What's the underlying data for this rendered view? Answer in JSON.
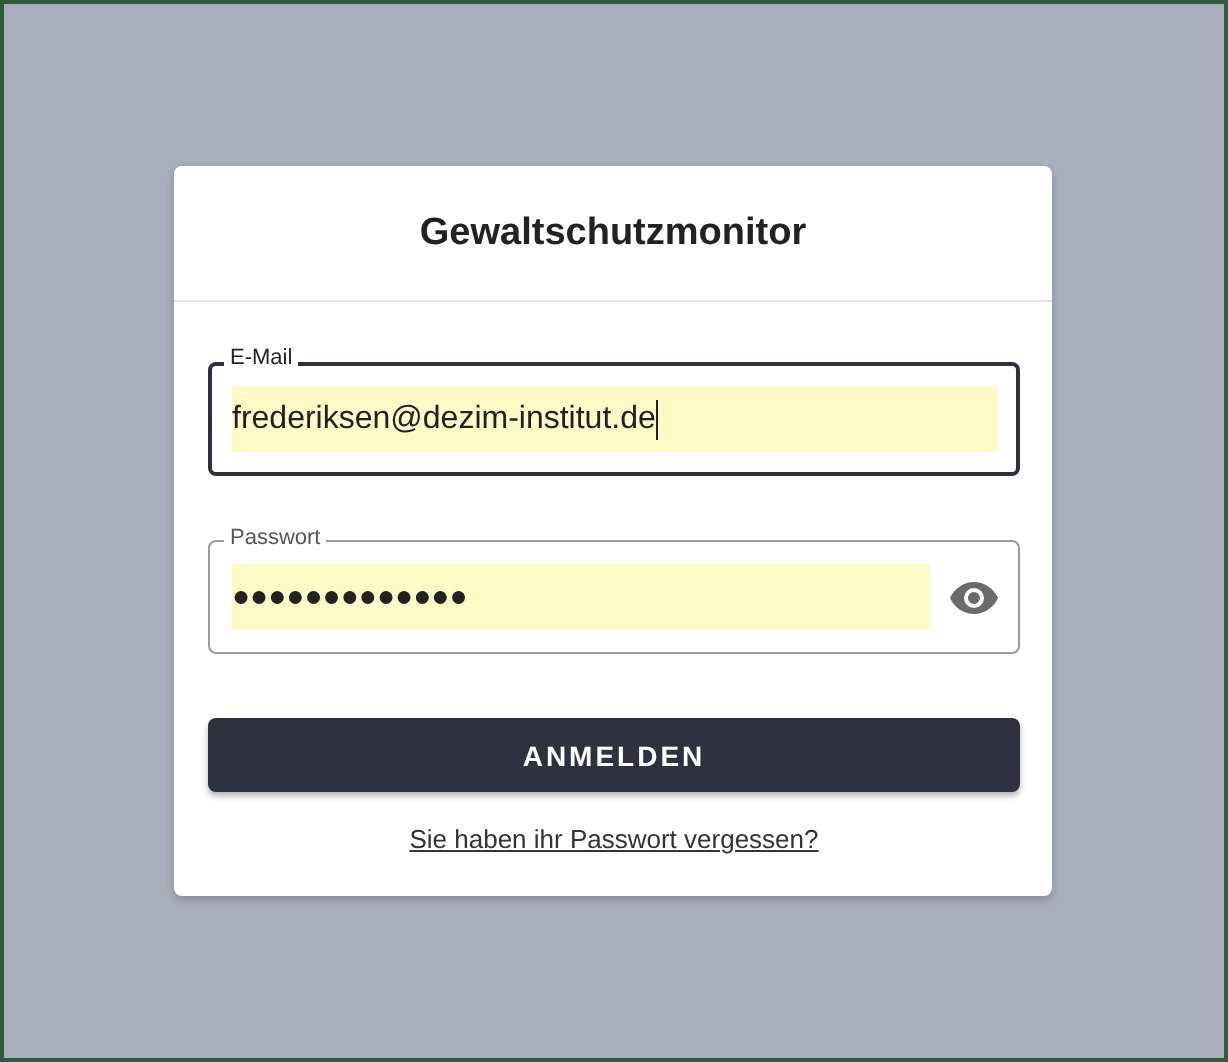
{
  "title": "Gewaltschutzmonitor",
  "fields": [
    {
      "kind": "text",
      "label": "E-Mail",
      "value": "frederiksen@dezim-institut.de",
      "focused": true
    },
    {
      "kind": "password",
      "label": "Passwort",
      "value": "●●●●●●●●●●●●●",
      "focused": false
    }
  ],
  "submit": "ANMELDEN",
  "forgot_link": "Sie haben ihr Passwort vergessen?"
}
